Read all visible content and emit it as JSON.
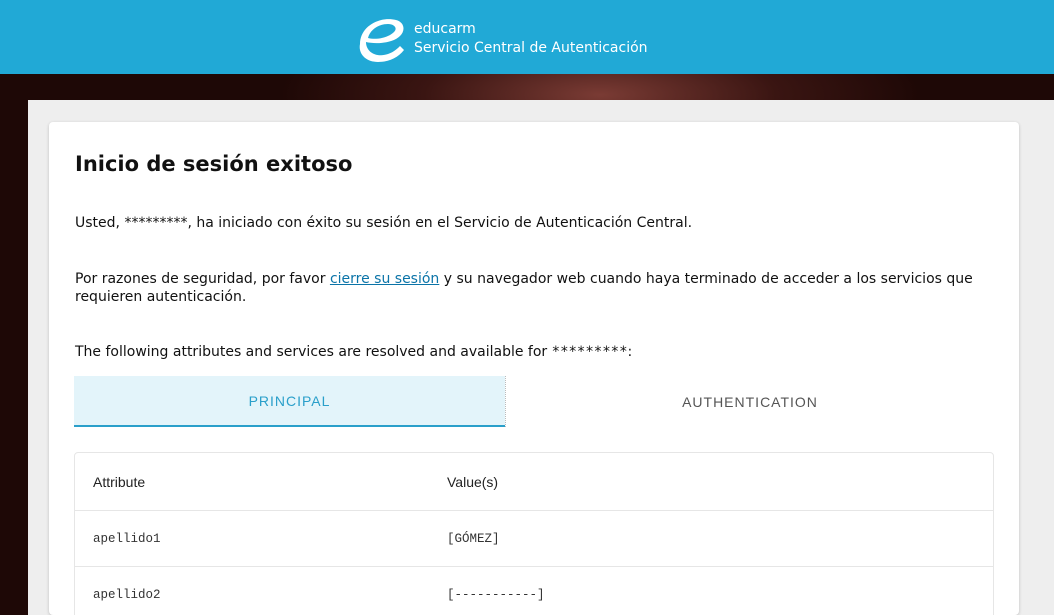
{
  "header": {
    "brand_name": "educarm",
    "service_name": "Servicio Central de Autenticación",
    "logo_icon": "educarm-e-logo-icon",
    "background_color": "#21a9d6"
  },
  "main": {
    "title": "Inicio de sesión exitoso",
    "success_line": {
      "prefix": "Usted, ",
      "username": "*********",
      "suffix": ", ha iniciado con éxito su sesión en el Servicio de Autenticación Central."
    },
    "security_line": {
      "prefix": "Por razones de seguridad, por favor ",
      "link_text": "cierre su sesión",
      "suffix": " y su navegador web cuando haya terminado de acceder a los servicios que requieren autenticación."
    },
    "attributes_line": {
      "prefix": "The following attributes and services are resolved and available for ",
      "username": "*********",
      "suffix": ":"
    },
    "tabs": [
      {
        "label": "PRINCIPAL",
        "active": true
      },
      {
        "label": "AUTHENTICATION",
        "active": false
      }
    ],
    "table": {
      "headers": [
        "Attribute",
        "Value(s)"
      ],
      "rows": [
        [
          "apellido1",
          "[GÓMEZ]"
        ],
        [
          "apellido2",
          "[-----------]"
        ]
      ]
    }
  },
  "colors": {
    "accent": "#2a9fca",
    "link": "#0b74a8",
    "active_tab_bg": "#e3f4fa"
  }
}
